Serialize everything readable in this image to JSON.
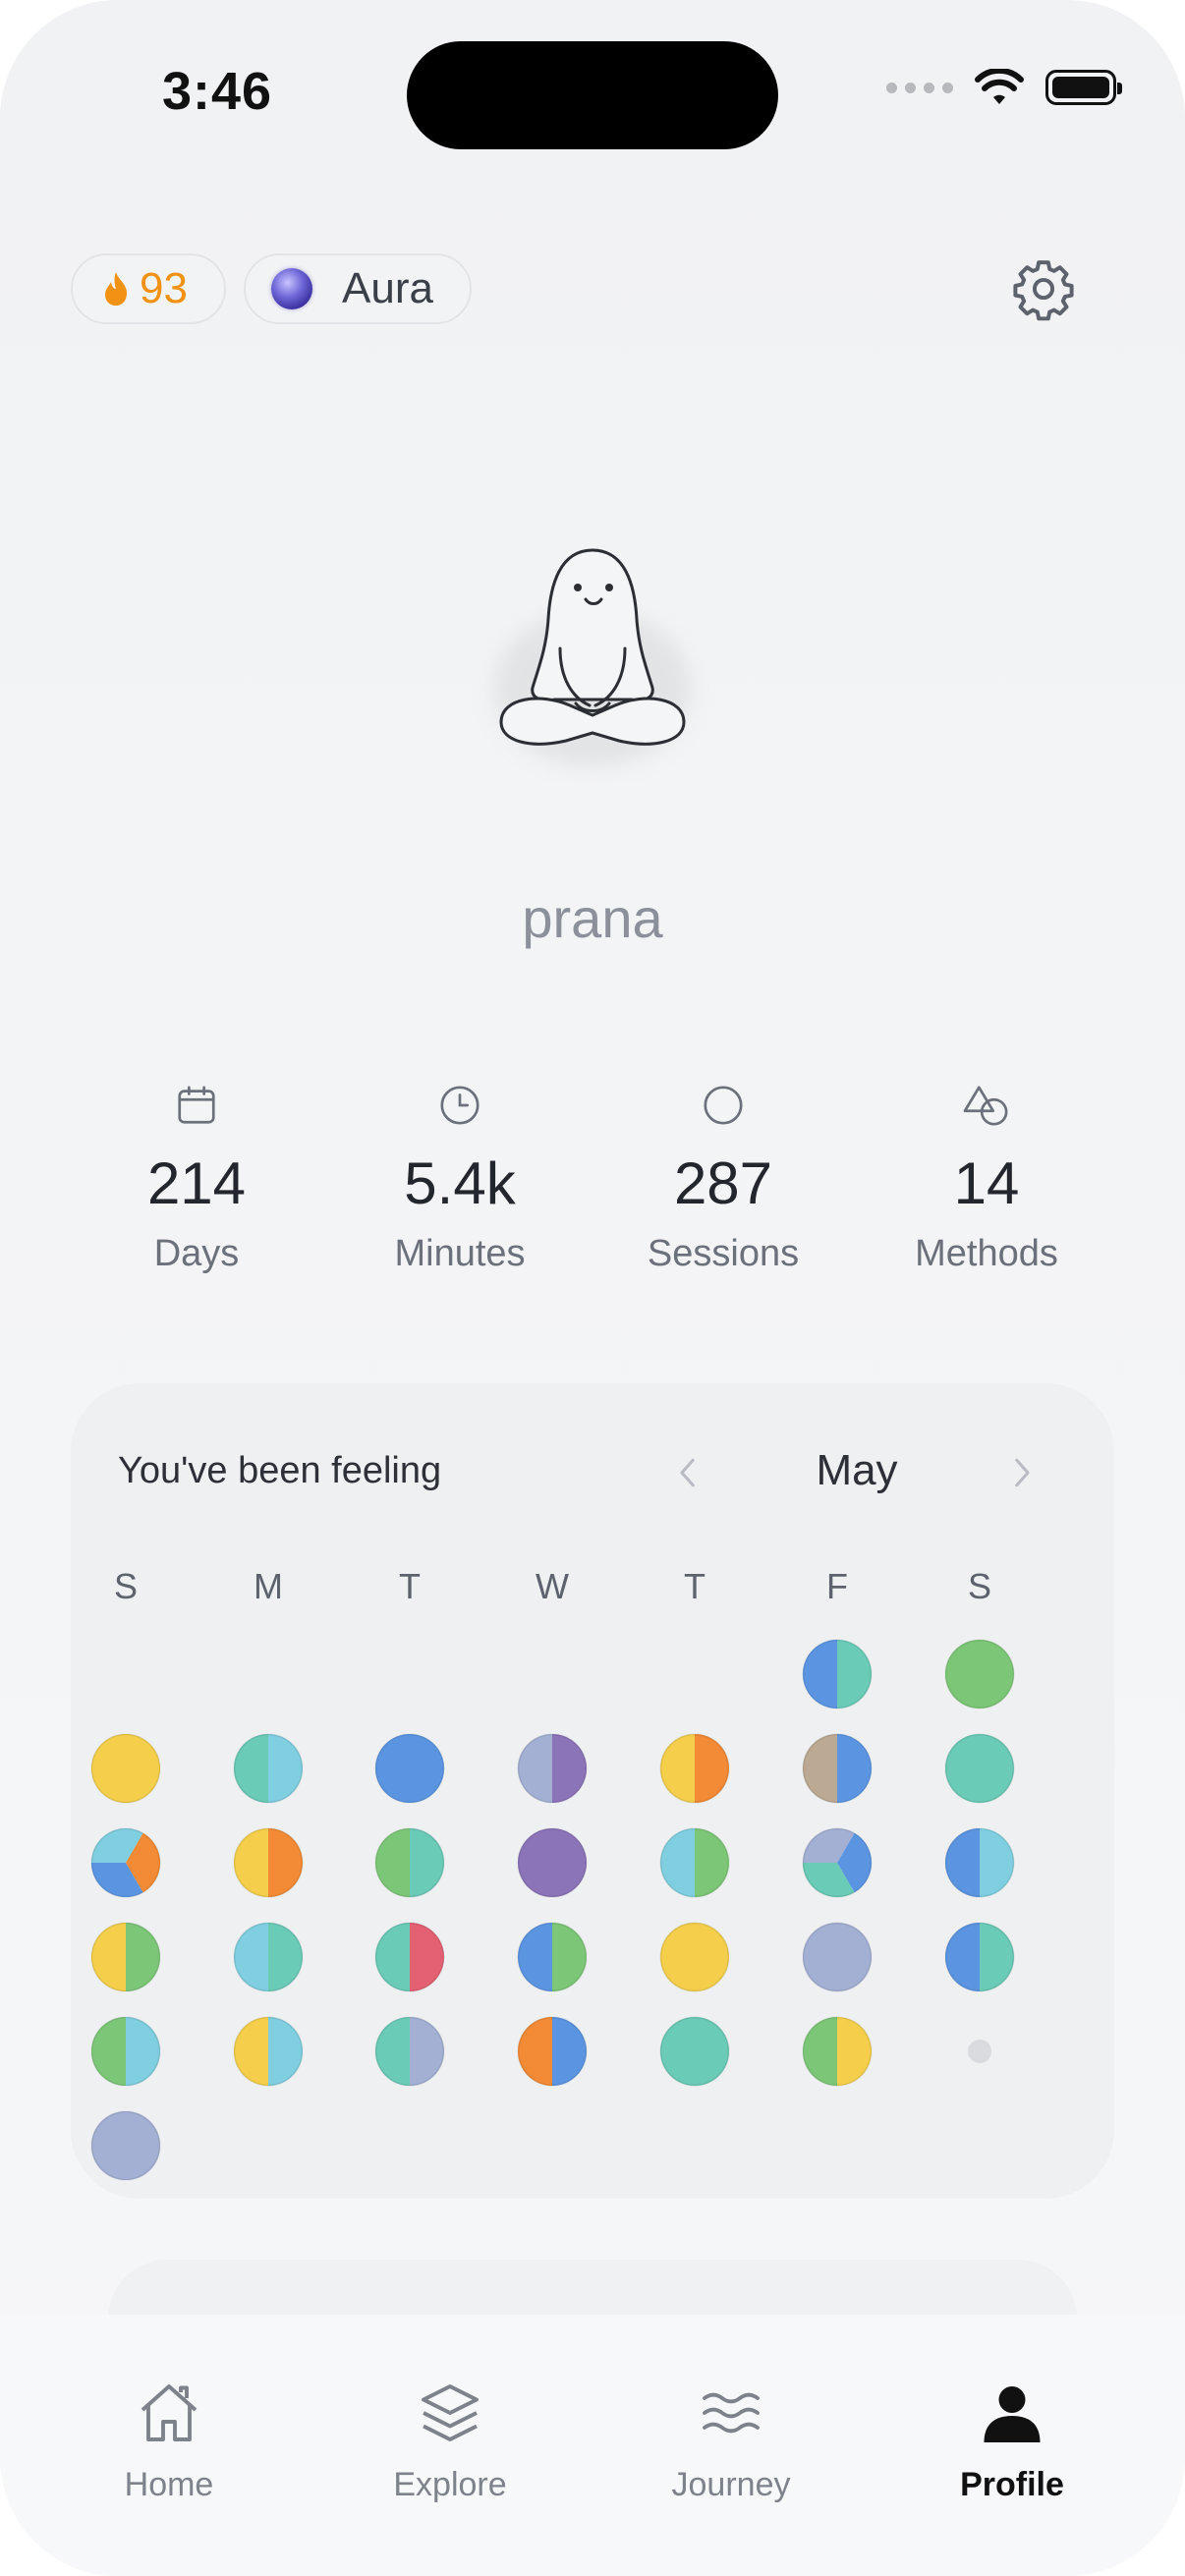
{
  "status_bar": {
    "time": "3:46"
  },
  "header": {
    "streak": {
      "icon": "flame-icon",
      "count": "93",
      "color": "#f29215"
    },
    "aura": {
      "icon": "aura-orb-icon",
      "label": "Aura"
    },
    "settings_icon": "gear-icon"
  },
  "profile": {
    "mascot": "meditating-ghost-mascot",
    "username": "prana"
  },
  "stats": [
    {
      "icon": "calendar-icon",
      "value": "214",
      "label": "Days"
    },
    {
      "icon": "clock-icon",
      "value": "5.4k",
      "label": "Minutes"
    },
    {
      "icon": "circle-icon",
      "value": "287",
      "label": "Sessions"
    },
    {
      "icon": "shapes-icon",
      "value": "14",
      "label": "Methods"
    }
  ],
  "calendar": {
    "title": "You've been feeling",
    "month": "May",
    "weekdays": [
      "S",
      "M",
      "T",
      "W",
      "T",
      "F",
      "S"
    ],
    "mood_colors": {
      "yellow": "#f5cf4b",
      "teal": "#6acbb7",
      "cyan": "#7fcfe0",
      "blue": "#5b95e2",
      "lavender": "#a3b0d4",
      "purple": "#8b74b8",
      "orange": "#f28a36",
      "tan": "#bba993",
      "green": "#7cc777",
      "red": "#e36173"
    },
    "days": [
      {
        "week": 0,
        "weekday": 5,
        "moods": [
          "blue",
          "teal"
        ]
      },
      {
        "week": 0,
        "weekday": 6,
        "moods": [
          "green"
        ]
      },
      {
        "week": 1,
        "weekday": 0,
        "moods": [
          "yellow"
        ]
      },
      {
        "week": 1,
        "weekday": 1,
        "moods": [
          "teal",
          "cyan"
        ]
      },
      {
        "week": 1,
        "weekday": 2,
        "moods": [
          "blue"
        ]
      },
      {
        "week": 1,
        "weekday": 3,
        "moods": [
          "lavender",
          "purple"
        ]
      },
      {
        "week": 1,
        "weekday": 4,
        "moods": [
          "yellow",
          "orange"
        ]
      },
      {
        "week": 1,
        "weekday": 5,
        "moods": [
          "tan",
          "blue"
        ]
      },
      {
        "week": 1,
        "weekday": 6,
        "moods": [
          "teal"
        ]
      },
      {
        "week": 2,
        "weekday": 0,
        "moods": [
          "orange",
          "blue",
          "cyan"
        ]
      },
      {
        "week": 2,
        "weekday": 1,
        "moods": [
          "yellow",
          "orange"
        ]
      },
      {
        "week": 2,
        "weekday": 2,
        "moods": [
          "green",
          "teal"
        ]
      },
      {
        "week": 2,
        "weekday": 3,
        "moods": [
          "purple"
        ]
      },
      {
        "week": 2,
        "weekday": 4,
        "moods": [
          "cyan",
          "green"
        ]
      },
      {
        "week": 2,
        "weekday": 5,
        "moods": [
          "blue",
          "teal",
          "lavender"
        ]
      },
      {
        "week": 2,
        "weekday": 6,
        "moods": [
          "blue",
          "cyan"
        ]
      },
      {
        "week": 3,
        "weekday": 0,
        "moods": [
          "yellow",
          "green"
        ]
      },
      {
        "week": 3,
        "weekday": 1,
        "moods": [
          "cyan",
          "teal"
        ]
      },
      {
        "week": 3,
        "weekday": 2,
        "moods": [
          "teal",
          "red"
        ]
      },
      {
        "week": 3,
        "weekday": 3,
        "moods": [
          "blue",
          "green"
        ]
      },
      {
        "week": 3,
        "weekday": 4,
        "moods": [
          "yellow"
        ]
      },
      {
        "week": 3,
        "weekday": 5,
        "moods": [
          "lavender"
        ]
      },
      {
        "week": 3,
        "weekday": 6,
        "moods": [
          "blue",
          "teal"
        ]
      },
      {
        "week": 4,
        "weekday": 0,
        "moods": [
          "green",
          "cyan"
        ]
      },
      {
        "week": 4,
        "weekday": 1,
        "moods": [
          "yellow",
          "cyan"
        ]
      },
      {
        "week": 4,
        "weekday": 2,
        "moods": [
          "teal",
          "lavender"
        ]
      },
      {
        "week": 4,
        "weekday": 3,
        "moods": [
          "orange",
          "blue"
        ]
      },
      {
        "week": 4,
        "weekday": 4,
        "moods": [
          "teal"
        ]
      },
      {
        "week": 4,
        "weekday": 5,
        "moods": [
          "green",
          "yellow"
        ]
      },
      {
        "week": 4,
        "weekday": 6,
        "moods": []
      },
      {
        "week": 5,
        "weekday": 0,
        "moods": [
          "lavender"
        ]
      }
    ]
  },
  "tabbar": [
    {
      "icon": "home-icon",
      "label": "Home",
      "active": false
    },
    {
      "icon": "layers-icon",
      "label": "Explore",
      "active": false
    },
    {
      "icon": "waves-icon",
      "label": "Journey",
      "active": false
    },
    {
      "icon": "person-icon",
      "label": "Profile",
      "active": true
    }
  ]
}
